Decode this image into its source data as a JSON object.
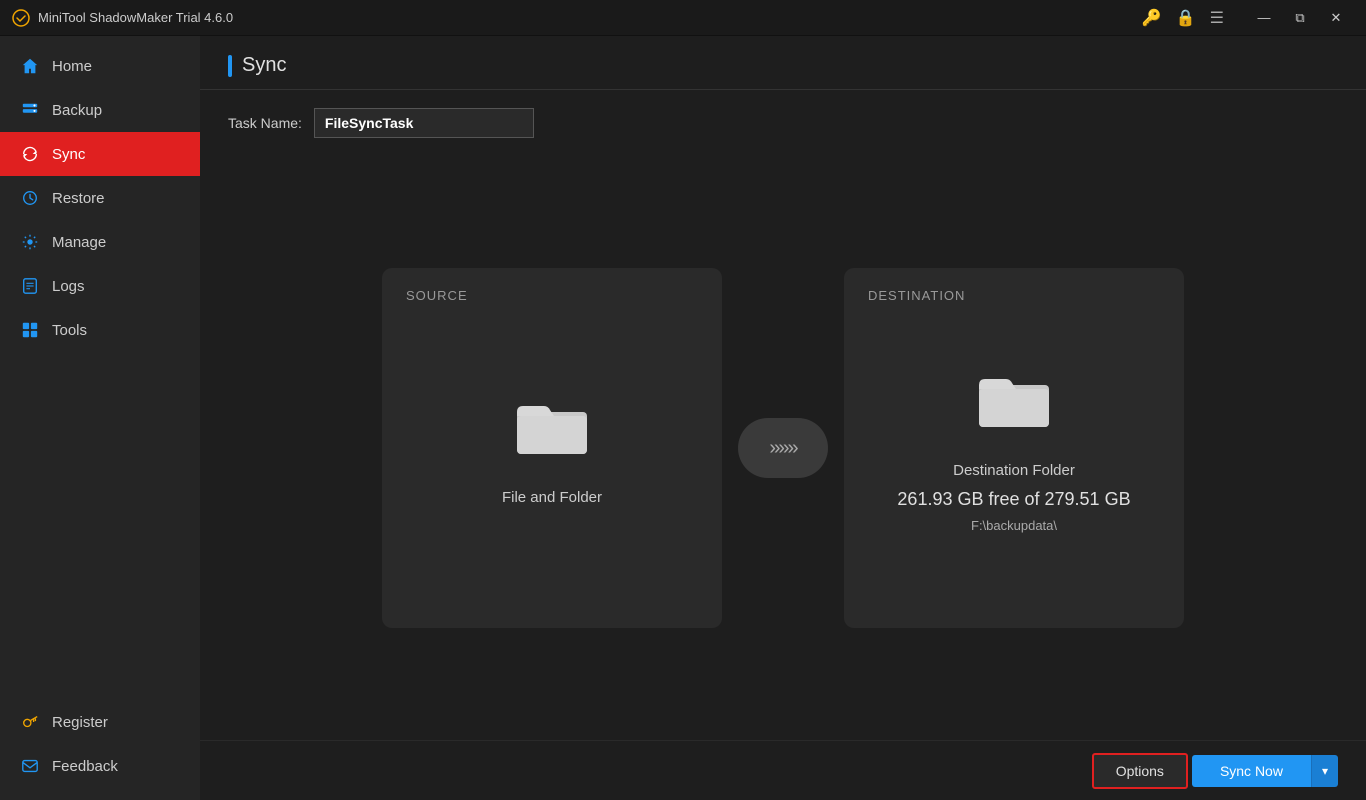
{
  "titleBar": {
    "appTitle": "MiniTool ShadowMaker Trial 4.6.0",
    "icons": {
      "key": "🔑",
      "lock": "🔒",
      "menu": "☰"
    },
    "windowControls": {
      "minimize": "—",
      "restore": "⧉",
      "close": "✕"
    }
  },
  "sidebar": {
    "items": [
      {
        "id": "home",
        "label": "Home",
        "icon": "home"
      },
      {
        "id": "backup",
        "label": "Backup",
        "icon": "backup"
      },
      {
        "id": "sync",
        "label": "Sync",
        "icon": "sync",
        "active": true
      },
      {
        "id": "restore",
        "label": "Restore",
        "icon": "restore"
      },
      {
        "id": "manage",
        "label": "Manage",
        "icon": "manage"
      },
      {
        "id": "logs",
        "label": "Logs",
        "icon": "logs"
      },
      {
        "id": "tools",
        "label": "Tools",
        "icon": "tools"
      }
    ],
    "bottomItems": [
      {
        "id": "register",
        "label": "Register",
        "icon": "key"
      },
      {
        "id": "feedback",
        "label": "Feedback",
        "icon": "mail"
      }
    ]
  },
  "page": {
    "title": "Sync",
    "taskNameLabel": "Task Name:",
    "taskNameValue": "FileSyncTask"
  },
  "source": {
    "label": "SOURCE",
    "title": "File and Folder"
  },
  "destination": {
    "label": "DESTINATION",
    "title": "Destination Folder",
    "freeSpace": "261.93 GB free of 279.51 GB",
    "path": "F:\\backupdata\\"
  },
  "buttons": {
    "options": "Options",
    "syncNow": "Sync Now",
    "dropdown": "▾"
  },
  "colors": {
    "accent": "#2196f3",
    "activeNav": "#e02020",
    "optionsBorder": "#e02020"
  }
}
